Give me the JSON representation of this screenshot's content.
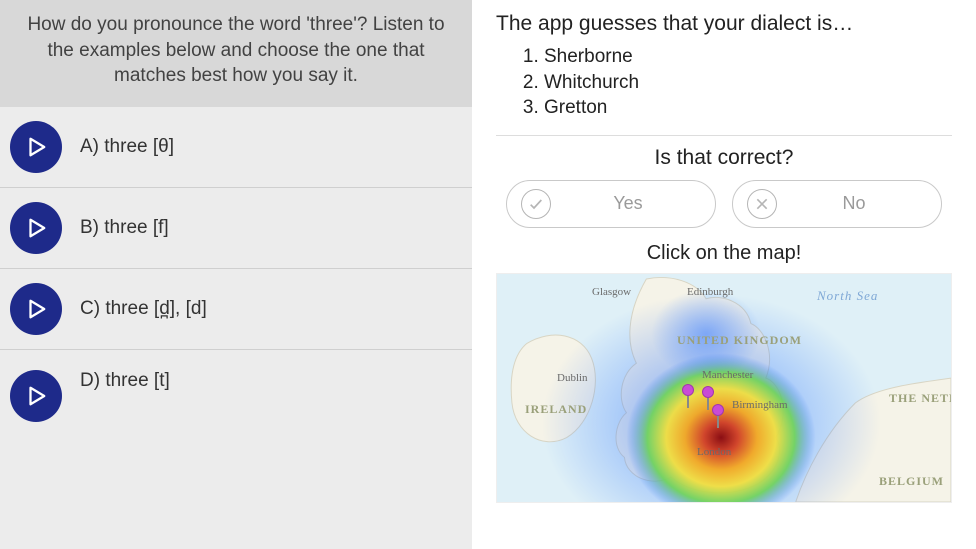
{
  "left": {
    "question": "How do you pronounce the word 'three'? Listen to the examples below and choose the one that matches best how you say it.",
    "options": [
      {
        "label": "A) three [θ]"
      },
      {
        "label": "B) three [f]"
      },
      {
        "label": "C) three [d̪], [d]"
      },
      {
        "label": "D) three [t]"
      }
    ]
  },
  "right": {
    "guess_title": "The app guesses that your dialect is…",
    "guesses": [
      "Sherborne",
      "Whitchurch",
      "Gretton"
    ],
    "confirm_title": "Is that correct?",
    "yes_label": "Yes",
    "no_label": "No",
    "map_title": "Click on the map!",
    "map_labels": {
      "glasgow": "Glasgow",
      "edinburgh": "Edinburgh",
      "north_sea": "North Sea",
      "dublin": "Dublin",
      "ireland": "IRELAND",
      "uk": "UNITED KINGDOM",
      "manchester": "Manchester",
      "birmingham": "Birmingham",
      "london": "London",
      "netherlands": "THE NETHERL",
      "belgium": "BELGIUM"
    }
  }
}
